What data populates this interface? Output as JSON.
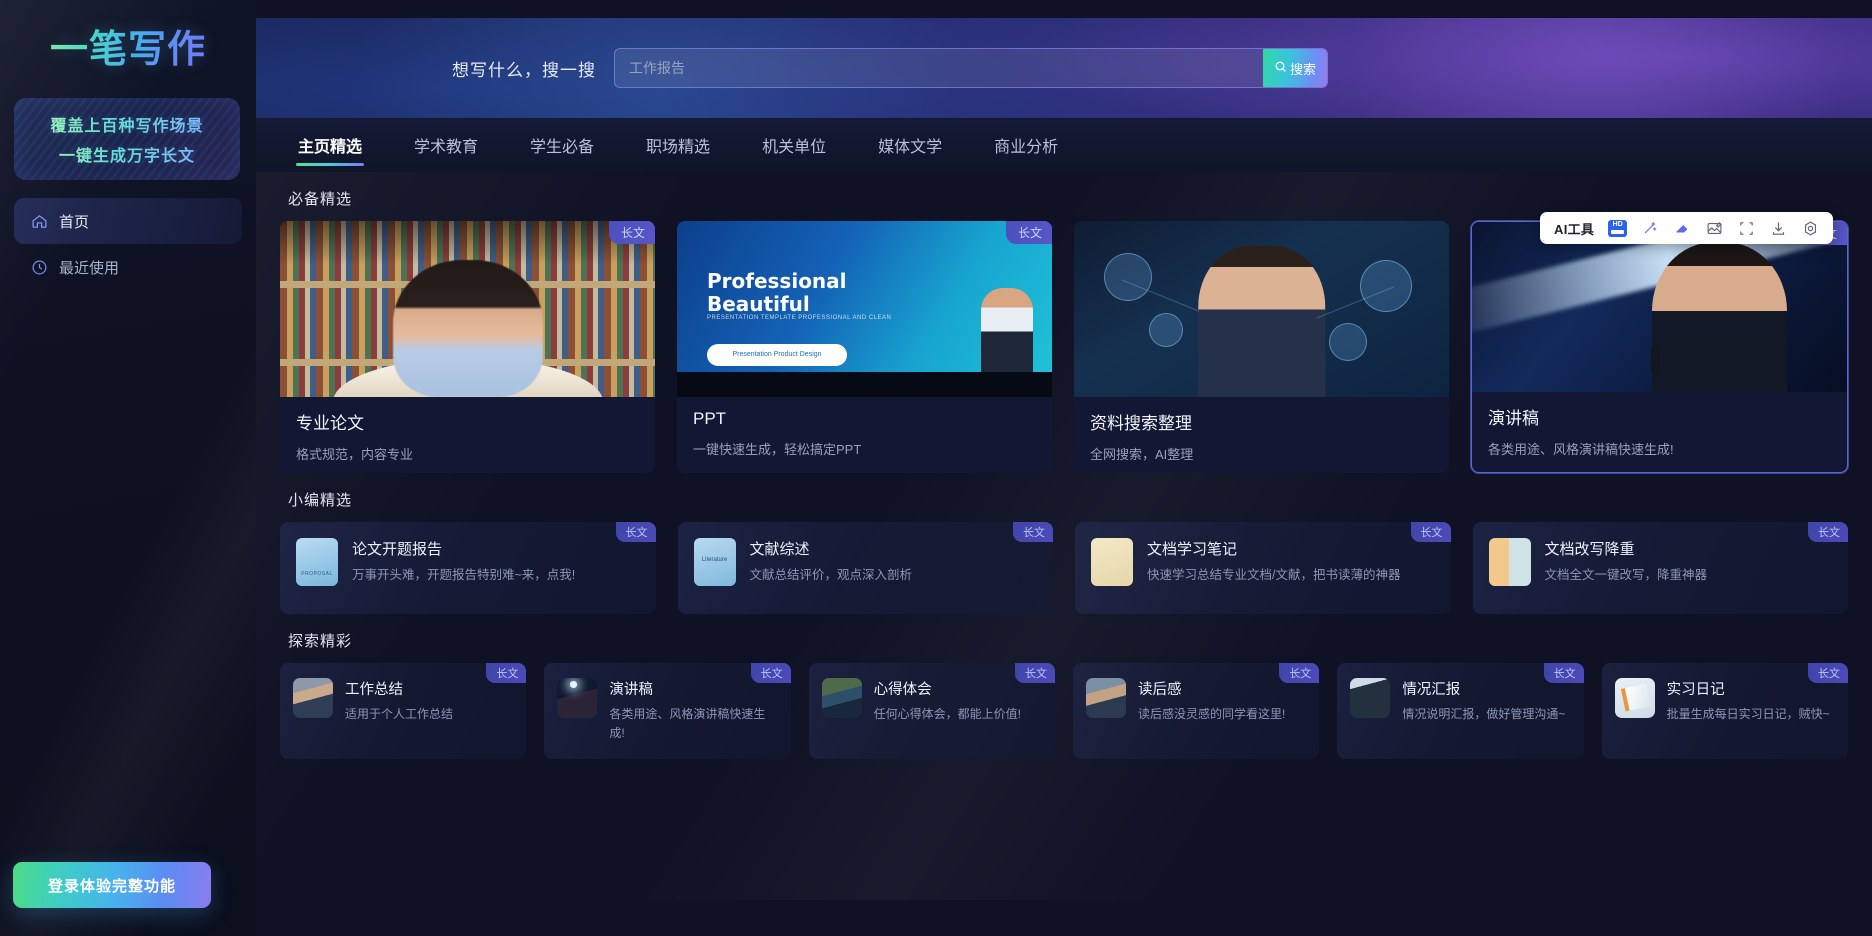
{
  "sidebar": {
    "logo": "一笔写作",
    "promo": {
      "line1": "覆盖上百种写作场景",
      "line2": "一键生成万字长文"
    },
    "nav": [
      {
        "label": "首页",
        "icon": "home-icon",
        "active": true
      },
      {
        "label": "最近使用",
        "icon": "clock-icon",
        "active": false
      }
    ],
    "login_button": "登录体验完整功能"
  },
  "hero": {
    "label": "想写什么，搜一搜",
    "search_value": "",
    "search_placeholder": "工作报告",
    "search_button": "搜索"
  },
  "tabs": [
    {
      "label": "主页精选",
      "active": true
    },
    {
      "label": "学术教育",
      "active": false
    },
    {
      "label": "学生必备",
      "active": false
    },
    {
      "label": "职场精选",
      "active": false
    },
    {
      "label": "机关单位",
      "active": false
    },
    {
      "label": "媒体文学",
      "active": false
    },
    {
      "label": "商业分析",
      "active": false
    }
  ],
  "toolbar": {
    "label": "AI工具",
    "icons": [
      "hd-icon",
      "magic-wand-icon",
      "eraser-icon",
      "image-edit-icon",
      "crop-icon",
      "download-icon",
      "settings-icon"
    ]
  },
  "sections": [
    {
      "title": "必备精选",
      "cards": [
        {
          "title": "专业论文",
          "desc": "格式规范，内容专业",
          "badge": "长文",
          "selected": false
        },
        {
          "title": "PPT",
          "desc": "一键快速生成，轻松搞定PPT",
          "badge": "长文",
          "selected": false
        },
        {
          "title": "资料搜索整理",
          "desc": "全网搜索，AI整理",
          "badge": "",
          "selected": false
        },
        {
          "title": "演讲稿",
          "desc": "各类用途、风格演讲稿快速生成!",
          "badge": "长文",
          "selected": true
        }
      ]
    },
    {
      "title": "小编精选",
      "cards": [
        {
          "title": "论文开题报告",
          "desc": "万事开头难，开题报告特别难~来，点我!",
          "badge": "长文"
        },
        {
          "title": "文献综述",
          "desc": "文献总结评价，观点深入剖析",
          "badge": "长文"
        },
        {
          "title": "文档学习笔记",
          "desc": "快速学习总结专业文档/文献，把书读薄的神器",
          "badge": "长文"
        },
        {
          "title": "文档改写降重",
          "desc": "文档全文一键改写，降重神器",
          "badge": "长文"
        }
      ]
    },
    {
      "title": "探索精彩",
      "cards": [
        {
          "title": "工作总结",
          "desc": "适用于个人工作总结",
          "badge": "长文"
        },
        {
          "title": "演讲稿",
          "desc": "各类用途、风格演讲稿快速生成!",
          "badge": "长文"
        },
        {
          "title": "心得体会",
          "desc": "任何心得体会，都能上价值!",
          "badge": "长文"
        },
        {
          "title": "读后感",
          "desc": "读后感没灵感的同学看这里!",
          "badge": "长文"
        },
        {
          "title": "情况汇报",
          "desc": "情况说明汇报，做好管理沟通~",
          "badge": "长文"
        },
        {
          "title": "实习日记",
          "desc": "批量生成每日实习日记，贼快~",
          "badge": "长文"
        }
      ]
    }
  ],
  "ppt_slide": {
    "title_line1": "Professional",
    "title_line2": "Beautiful",
    "subtitle": "PRESENTATION TEMPLATE\nPROFESSIONAL AND CLEAN",
    "button": "Presentation Product Design"
  },
  "colors": {
    "accent_green": "#4ddb86",
    "accent_blue": "#46b4ec",
    "accent_purple": "#8b7cf0",
    "badge_bg": "#4a4fbc",
    "panel_bg": "#0e1224"
  }
}
